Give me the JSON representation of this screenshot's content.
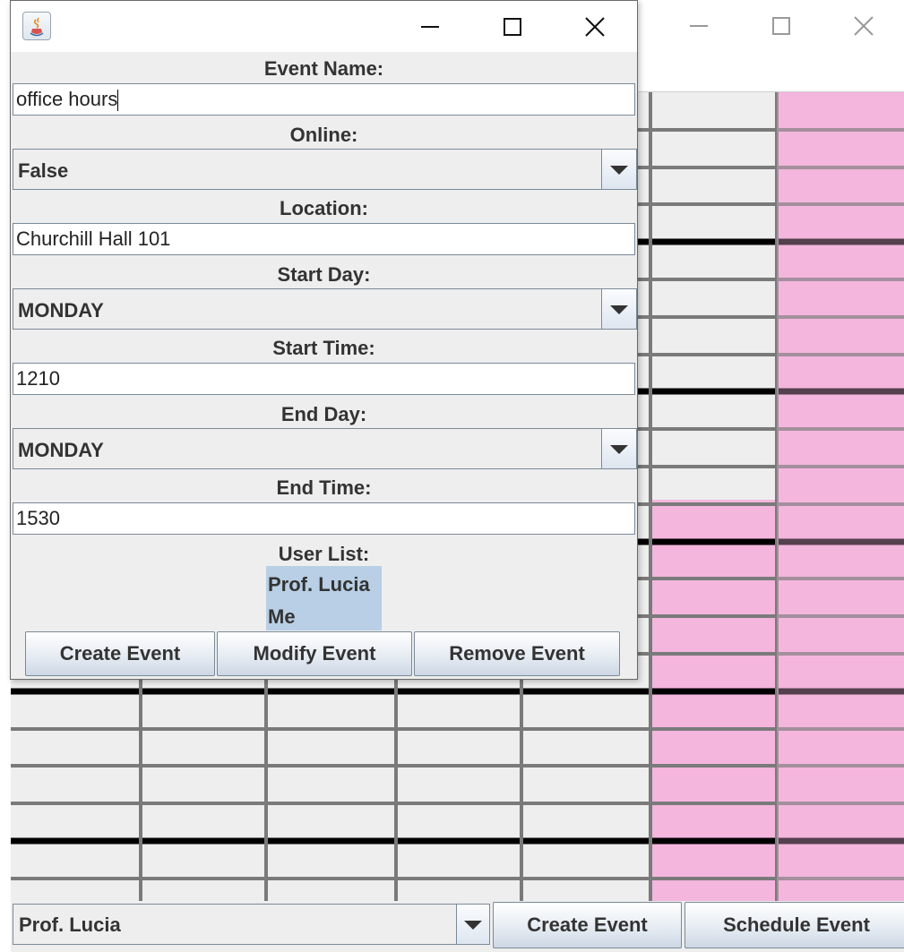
{
  "main_window": {
    "title_controls": {
      "minimize": "minimize-icon",
      "maximize": "maximize-icon",
      "close": "close-icon"
    },
    "calendar": {
      "event_color": "#f4b6dd",
      "grid_color": "#7a7a7a",
      "divider_color": "#000000"
    },
    "bottom_bar": {
      "user_select_value": "Prof. Lucia",
      "create_event_label": "Create Event",
      "schedule_event_label": "Schedule Event"
    }
  },
  "dialog": {
    "icon": "java-icon",
    "title_controls": {
      "minimize": "minimize-icon",
      "maximize": "maximize-icon",
      "close": "close-icon"
    },
    "event_name_label": "Event Name:",
    "event_name_value": "office hours",
    "online_label": "Online:",
    "online_value": "False",
    "location_label": "Location:",
    "location_value": "Churchill Hall 101",
    "start_day_label": "Start Day:",
    "start_day_value": "MONDAY",
    "start_time_label": "Start Time:",
    "start_time_value": "1210",
    "end_day_label": "End Day:",
    "end_day_value": "MONDAY",
    "end_time_label": "End Time:",
    "end_time_value": "1530",
    "user_list_label": "User List:",
    "user_list": [
      "Prof. Lucia",
      "Me"
    ],
    "create_event_label": "Create Event",
    "modify_event_label": "Modify Event",
    "remove_event_label": "Remove Event",
    "accent_color": "#b8cfe5"
  }
}
